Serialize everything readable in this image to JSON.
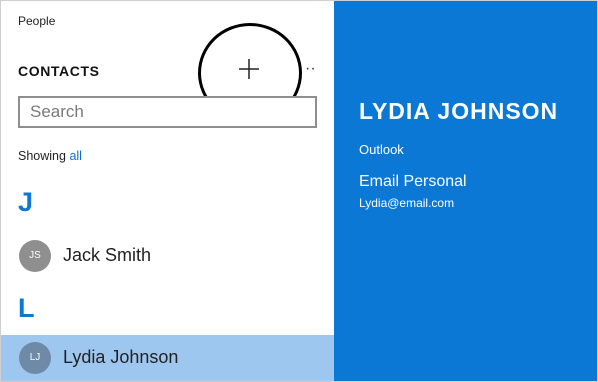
{
  "app": {
    "title": "People"
  },
  "contacts_panel": {
    "heading": "CONTACTS",
    "add_icon": "plus-icon",
    "more_label": "··",
    "search": {
      "placeholder": "Search",
      "value": ""
    },
    "showing": {
      "prefix": "Showing ",
      "filter": "all"
    },
    "groups": [
      {
        "letter": "J",
        "contacts": [
          {
            "initials": "JS",
            "name": "Jack Smith"
          }
        ]
      },
      {
        "letter": "L",
        "contacts": [
          {
            "initials": "LJ",
            "name": "Lydia Johnson",
            "selected": true
          }
        ]
      }
    ]
  },
  "detail": {
    "name": "LYDIA JOHNSON",
    "source": "Outlook",
    "email_label": "Email Personal",
    "email": "Lydia@email.com"
  },
  "colors": {
    "accent": "#0a78d4",
    "selected_row": "#9ec7f0",
    "link": "#0a6fcf"
  }
}
